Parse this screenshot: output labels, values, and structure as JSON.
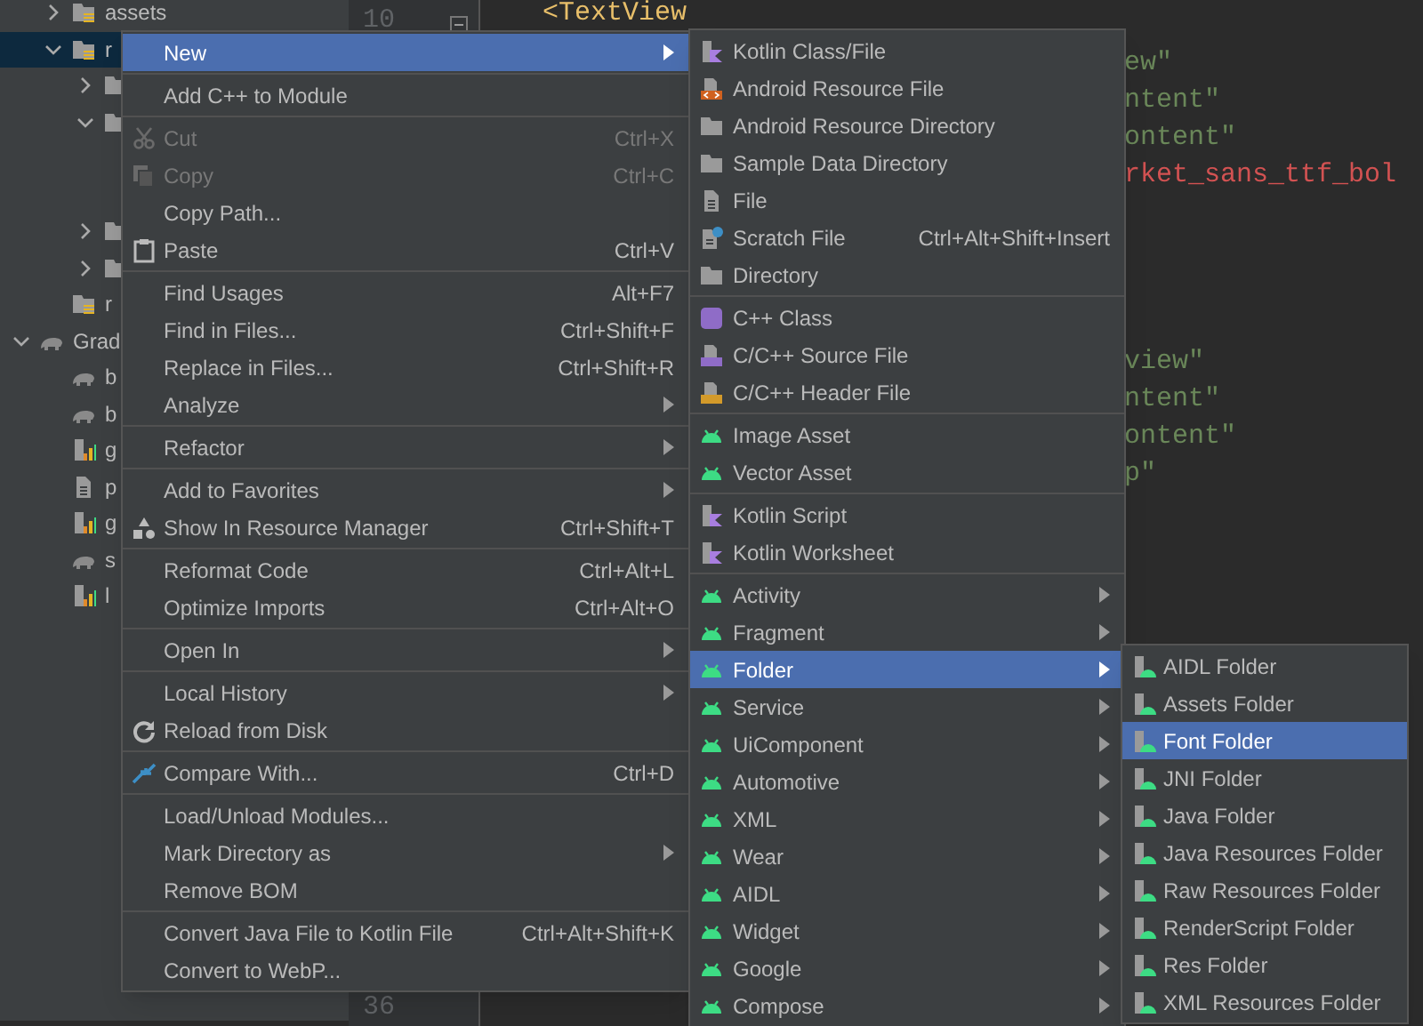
{
  "project_tree": [
    {
      "children": [
        {
          "label": "assets",
          "kind": "resource-folder",
          "expanded": false,
          "selected": false
        },
        {
          "label": "r",
          "kind": "resource-folder",
          "expanded": true,
          "selected": true,
          "children": [
            {
              "kind": "folder",
              "expanded": false,
              "selected": false
            },
            {
              "kind": "folder",
              "expanded": true,
              "selected": false
            },
            {
              "kind": "folder",
              "expanded": false,
              "selected": false
            },
            {
              "kind": "folder",
              "expanded": false,
              "selected": false
            }
          ]
        },
        {
          "label": "r",
          "kind": "resource-folder",
          "selected": false
        }
      ]
    },
    {
      "label": "Grad",
      "kind": "gradle",
      "expanded": true,
      "selected": false,
      "children": [
        {
          "label": "b",
          "kind": "gradle",
          "selected": false
        },
        {
          "label": "b",
          "kind": "gradle",
          "selected": false
        },
        {
          "label": "g",
          "kind": "chart",
          "selected": false
        },
        {
          "label": "p",
          "kind": "file",
          "selected": false
        },
        {
          "label": "g",
          "kind": "chart",
          "selected": false
        },
        {
          "label": "s",
          "kind": "gradle",
          "selected": false
        },
        {
          "label": "l",
          "kind": "chart",
          "selected": false
        }
      ]
    }
  ],
  "editor": {
    "line_numbers": [
      "10",
      "36"
    ],
    "code_blocks": [
      {
        "lines": [
          {
            "text": "<TextView",
            "kind": "tag"
          }
        ]
      },
      {
        "lines": [
          {
            "text": "ew\"",
            "kind": "string"
          },
          {
            "text": "ntent\"",
            "kind": "string"
          },
          {
            "text": "ontent\"",
            "kind": "string"
          },
          {
            "text": "rket_sans_ttf_bol",
            "kind": "error"
          }
        ]
      },
      {
        "lines": [
          {
            "text": "view\"",
            "kind": "string"
          },
          {
            "text": "ntent\"",
            "kind": "string"
          },
          {
            "text": "ontent\"",
            "kind": "string"
          },
          {
            "text": "p\"",
            "kind": "string"
          }
        ]
      }
    ]
  },
  "context_menu": [
    [
      {
        "label": "New",
        "selected": true,
        "submenu": true,
        "disabled": false
      }
    ],
    [
      {
        "label": "Add C++ to Module",
        "selected": false,
        "submenu": false,
        "disabled": false
      }
    ],
    [
      {
        "label": "Cut",
        "shortcut": "Ctrl+X",
        "kind": "scissors",
        "selected": false,
        "submenu": false,
        "disabled": true
      },
      {
        "label": "Copy",
        "shortcut": "Ctrl+C",
        "kind": "copy",
        "selected": false,
        "submenu": false,
        "disabled": true
      },
      {
        "label": "Copy Path...",
        "selected": false,
        "submenu": false,
        "disabled": false
      },
      {
        "label": "Paste",
        "shortcut": "Ctrl+V",
        "kind": "clipboard",
        "selected": false,
        "submenu": false,
        "disabled": false
      }
    ],
    [
      {
        "label": "Find Usages",
        "shortcut": "Alt+F7",
        "selected": false,
        "submenu": false,
        "disabled": false
      },
      {
        "label": "Find in Files...",
        "shortcut": "Ctrl+Shift+F",
        "selected": false,
        "submenu": false,
        "disabled": false
      },
      {
        "label": "Replace in Files...",
        "shortcut": "Ctrl+Shift+R",
        "selected": false,
        "submenu": false,
        "disabled": false
      },
      {
        "label": "Analyze",
        "selected": false,
        "submenu": true,
        "disabled": false
      }
    ],
    [
      {
        "label": "Refactor",
        "selected": false,
        "submenu": true,
        "disabled": false
      }
    ],
    [
      {
        "label": "Add to Favorites",
        "selected": false,
        "submenu": true,
        "disabled": false
      },
      {
        "label": "Show In Resource Manager",
        "shortcut": "Ctrl+Shift+T",
        "kind": "shapes",
        "selected": false,
        "submenu": false,
        "disabled": false
      }
    ],
    [
      {
        "label": "Reformat Code",
        "shortcut": "Ctrl+Alt+L",
        "selected": false,
        "submenu": false,
        "disabled": false
      },
      {
        "label": "Optimize Imports",
        "shortcut": "Ctrl+Alt+O",
        "selected": false,
        "submenu": false,
        "disabled": false
      }
    ],
    [
      {
        "label": "Open In",
        "selected": false,
        "submenu": true,
        "disabled": false
      }
    ],
    [
      {
        "label": "Local History",
        "selected": false,
        "submenu": true,
        "disabled": false
      },
      {
        "label": "Reload from Disk",
        "kind": "reload",
        "selected": false,
        "submenu": false,
        "disabled": false
      }
    ],
    [
      {
        "label": "Compare With...",
        "shortcut": "Ctrl+D",
        "kind": "compare",
        "selected": false,
        "submenu": false,
        "disabled": false
      }
    ],
    [
      {
        "label": "Load/Unload Modules...",
        "selected": false,
        "submenu": false,
        "disabled": false
      },
      {
        "label": "Mark Directory as",
        "selected": false,
        "submenu": true,
        "disabled": false
      },
      {
        "label": "Remove BOM",
        "selected": false,
        "submenu": false,
        "disabled": false
      }
    ],
    [
      {
        "label": "Convert Java File to Kotlin File",
        "shortcut": "Ctrl+Alt+Shift+K",
        "selected": false,
        "submenu": false,
        "disabled": false
      },
      {
        "label": "Convert to WebP...",
        "selected": false,
        "submenu": false,
        "disabled": false
      }
    ]
  ],
  "new_submenu": [
    [
      {
        "label": "Kotlin Class/File",
        "kind": "kotlin",
        "selected": false,
        "submenu": false
      },
      {
        "label": "Android Resource File",
        "kind": "res-file",
        "selected": false,
        "submenu": false
      },
      {
        "label": "Android Resource Directory",
        "kind": "folder",
        "selected": false,
        "submenu": false
      },
      {
        "label": "Sample Data Directory",
        "kind": "folder",
        "selected": false,
        "submenu": false
      },
      {
        "label": "File",
        "kind": "file",
        "selected": false,
        "submenu": false
      },
      {
        "label": "Scratch File",
        "shortcut": "Ctrl+Alt+Shift+Insert",
        "kind": "scratch",
        "selected": false,
        "submenu": false
      },
      {
        "label": "Directory",
        "kind": "folder",
        "selected": false,
        "submenu": false
      }
    ],
    [
      {
        "label": "C++ Class",
        "kind": "cpp-class",
        "selected": false,
        "submenu": false
      },
      {
        "label": "C/C++ Source File",
        "kind": "cpp-source",
        "selected": false,
        "submenu": false
      },
      {
        "label": "C/C++ Header File",
        "kind": "cpp-header",
        "selected": false,
        "submenu": false
      }
    ],
    [
      {
        "label": "Image Asset",
        "kind": "android",
        "selected": false,
        "submenu": false
      },
      {
        "label": "Vector Asset",
        "kind": "android",
        "selected": false,
        "submenu": false
      }
    ],
    [
      {
        "label": "Kotlin Script",
        "kind": "kotlin",
        "selected": false,
        "submenu": false
      },
      {
        "label": "Kotlin Worksheet",
        "kind": "kotlin",
        "selected": false,
        "submenu": false
      }
    ],
    [
      {
        "label": "Activity",
        "kind": "android",
        "selected": false,
        "submenu": true
      },
      {
        "label": "Fragment",
        "kind": "android",
        "selected": false,
        "submenu": true
      },
      {
        "label": "Folder",
        "kind": "android",
        "selected": true,
        "submenu": true
      },
      {
        "label": "Service",
        "kind": "android",
        "selected": false,
        "submenu": true
      },
      {
        "label": "UiComponent",
        "kind": "android",
        "selected": false,
        "submenu": true
      },
      {
        "label": "Automotive",
        "kind": "android",
        "selected": false,
        "submenu": true
      },
      {
        "label": "XML",
        "kind": "android",
        "selected": false,
        "submenu": true
      },
      {
        "label": "Wear",
        "kind": "android",
        "selected": false,
        "submenu": true
      },
      {
        "label": "AIDL",
        "kind": "android",
        "selected": false,
        "submenu": true
      },
      {
        "label": "Widget",
        "kind": "android",
        "selected": false,
        "submenu": true
      },
      {
        "label": "Google",
        "kind": "android",
        "selected": false,
        "submenu": true
      },
      {
        "label": "Compose",
        "kind": "android",
        "selected": false,
        "submenu": true
      }
    ]
  ],
  "folder_submenu": [
    [
      {
        "label": "AIDL Folder",
        "kind": "android-file",
        "selected": false
      },
      {
        "label": "Assets Folder",
        "kind": "android-file",
        "selected": false
      },
      {
        "label": "Font Folder",
        "kind": "android-file",
        "selected": true
      },
      {
        "label": "JNI Folder",
        "kind": "android-file",
        "selected": false
      },
      {
        "label": "Java Folder",
        "kind": "android-file",
        "selected": false
      },
      {
        "label": "Java Resources Folder",
        "kind": "android-file",
        "selected": false
      },
      {
        "label": "Raw Resources Folder",
        "kind": "android-file",
        "selected": false
      },
      {
        "label": "RenderScript Folder",
        "kind": "android-file",
        "selected": false
      },
      {
        "label": "Res Folder",
        "kind": "android-file",
        "selected": false
      },
      {
        "label": "XML Resources Folder",
        "kind": "android-file",
        "selected": false
      }
    ]
  ]
}
